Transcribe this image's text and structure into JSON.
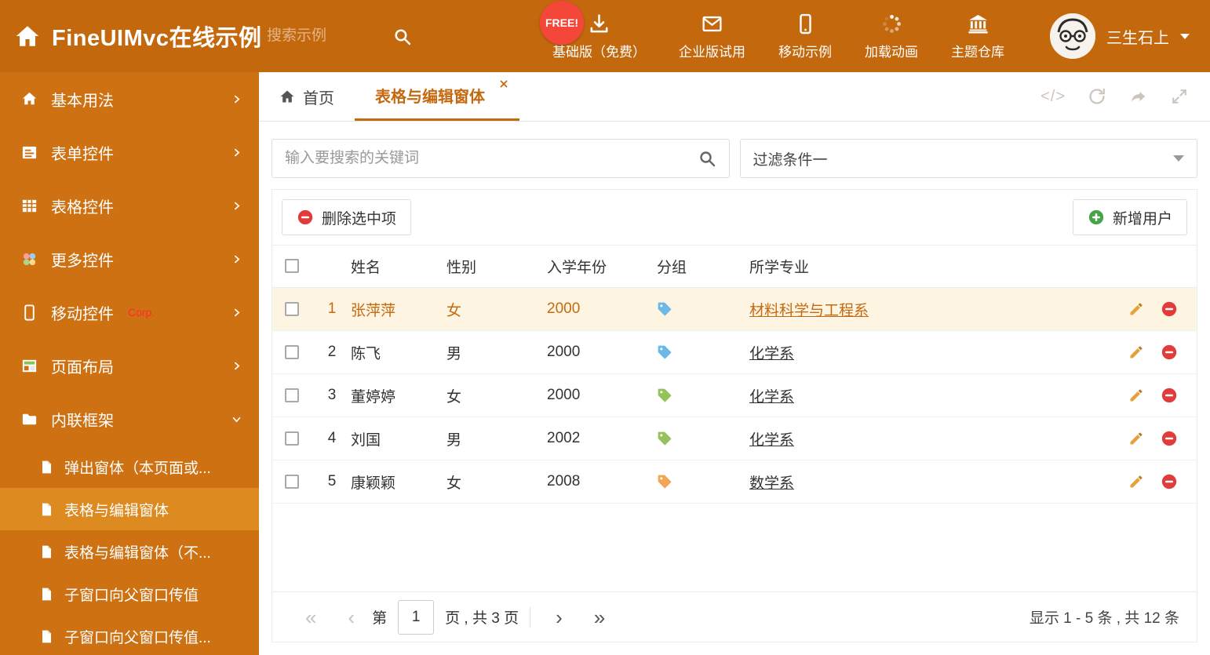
{
  "header": {
    "title": "FineUIMvc在线示例",
    "search_placeholder": "搜索示例",
    "free_badge": "FREE!",
    "nav": [
      {
        "label": "基础版（免费）"
      },
      {
        "label": "企业版试用"
      },
      {
        "label": "移动示例"
      },
      {
        "label": "加载动画"
      },
      {
        "label": "主题仓库"
      }
    ],
    "username": "三生石上"
  },
  "sidebar": {
    "items": [
      {
        "label": "基本用法"
      },
      {
        "label": "表单控件"
      },
      {
        "label": "表格控件"
      },
      {
        "label": "更多控件"
      },
      {
        "label": "移动控件",
        "badge": "Corp."
      },
      {
        "label": "页面布局"
      },
      {
        "label": "内联框架"
      }
    ],
    "subitems": [
      {
        "label": "弹出窗体（本页面或..."
      },
      {
        "label": "表格与编辑窗体"
      },
      {
        "label": "表格与编辑窗体（不..."
      },
      {
        "label": "子窗口向父窗口传值"
      },
      {
        "label": "子窗口向父窗口传值..."
      }
    ]
  },
  "tabs": {
    "home_label": "首页",
    "active_label": "表格与编辑窗体",
    "code_glyph": "</>"
  },
  "filters": {
    "search_placeholder": "输入要搜索的关键词",
    "filter_selected": "过滤条件一"
  },
  "toolbar": {
    "delete_label": "删除选中项",
    "add_label": "新增用户"
  },
  "table": {
    "columns": [
      "姓名",
      "性别",
      "入学年份",
      "分组",
      "所学专业"
    ],
    "rows": [
      {
        "index": "1",
        "name": "张萍萍",
        "gender": "女",
        "year": "2000",
        "tag_color": "#6cb8e6",
        "major": "材料科学与工程系",
        "highlighted": true
      },
      {
        "index": "2",
        "name": "陈飞",
        "gender": "男",
        "year": "2000",
        "tag_color": "#6cb8e6",
        "major": "化学系",
        "highlighted": false
      },
      {
        "index": "3",
        "name": "董婷婷",
        "gender": "女",
        "year": "2000",
        "tag_color": "#94c35c",
        "major": "化学系",
        "highlighted": false
      },
      {
        "index": "4",
        "name": "刘国",
        "gender": "男",
        "year": "2002",
        "tag_color": "#94c35c",
        "major": "化学系",
        "highlighted": false
      },
      {
        "index": "5",
        "name": "康颖颖",
        "gender": "女",
        "year": "2008",
        "tag_color": "#f2a654",
        "major": "数学系",
        "highlighted": false
      }
    ]
  },
  "pagination": {
    "first_glyph": "«",
    "prev_glyph": "‹",
    "page_prefix": "第",
    "current_page": "1",
    "page_suffix": "页 , 共 3 页",
    "next_glyph": "›",
    "last_glyph": "»",
    "summary": "显示 1 - 5 条 , 共 12 条"
  },
  "colors": {
    "accent": "#c5690f",
    "header_bg": "#c4680e",
    "sidebar_bg": "#cd7113",
    "sidebar_active_bg": "#dd8a20",
    "row_highlight_bg": "#fdf5e1",
    "delete_red": "#e23b3b",
    "add_green": "#47a447",
    "free_badge_red": "#f4473a"
  }
}
